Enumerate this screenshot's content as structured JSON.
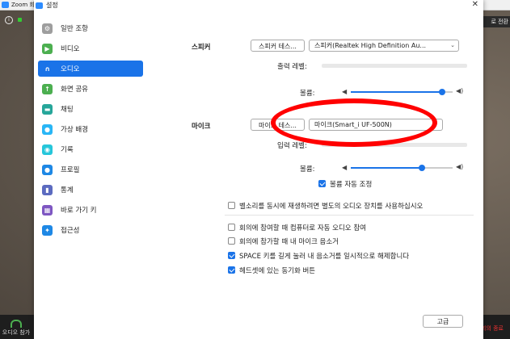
{
  "background": {
    "tab_title": "Zoom 회",
    "status_icon": "i",
    "right_button": "로 전환",
    "join_audio": "오디오 참가",
    "end_label": "회의 종료"
  },
  "dialog": {
    "title": "설정",
    "close": "✕"
  },
  "sidebar": {
    "items": [
      {
        "label": "일반 조항",
        "icon": "gear-icon",
        "color": "#9e9e9e"
      },
      {
        "label": "비디오",
        "icon": "video-icon",
        "color": "#4caf50"
      },
      {
        "label": "오디오",
        "icon": "headphones-icon",
        "color": "#1a73e8"
      },
      {
        "label": "화면 공유",
        "icon": "share-screen-icon",
        "color": "#4caf50"
      },
      {
        "label": "채팅",
        "icon": "chat-icon",
        "color": "#26a69a"
      },
      {
        "label": "가상 배경",
        "icon": "person-icon",
        "color": "#29b6f6"
      },
      {
        "label": "기록",
        "icon": "record-icon",
        "color": "#26c6da"
      },
      {
        "label": "프로필",
        "icon": "profile-icon",
        "color": "#1e88e5"
      },
      {
        "label": "통계",
        "icon": "stats-icon",
        "color": "#5c6bc0"
      },
      {
        "label": "바로 가기 키",
        "icon": "keyboard-icon",
        "color": "#7e57c2"
      },
      {
        "label": "접근성",
        "icon": "accessibility-icon",
        "color": "#1e88e5"
      }
    ],
    "active_index": 2
  },
  "audio": {
    "speaker_label": "스피커",
    "speaker_test": "스피커 테스...",
    "speaker_device": "스피커(Realtek High Definition Au...",
    "output_level_label": "출력 레벨:",
    "volume_label": "볼륨:",
    "speaker_volume": 0.9,
    "mic_label": "마이크",
    "mic_test": "마이크 테스...",
    "mic_device": "마이크(Smart_i UF-500N)",
    "input_level_label": "입력 레벨:",
    "mic_volume": 0.7,
    "auto_adjust_label": "볼륨 자동 조정",
    "auto_adjust_checked": true,
    "separate_device_label": "벨소리를 동시에 재생하려면 별도의 오디오 장치를 사용하십시오",
    "separate_device_checked": false,
    "options": [
      {
        "label": "회의에 참여할 때 컴퓨터로 자동 오디오 참여",
        "checked": false
      },
      {
        "label": "회의에 참가할 때 내 마이크 음소거",
        "checked": false
      },
      {
        "label": "SPACE 키를 길게 눌러 내 음소거를 일시적으로 해제합니다",
        "checked": true
      },
      {
        "label": "헤드셋에 있는 동기화 버튼",
        "checked": true
      }
    ],
    "advanced_button": "고급"
  }
}
